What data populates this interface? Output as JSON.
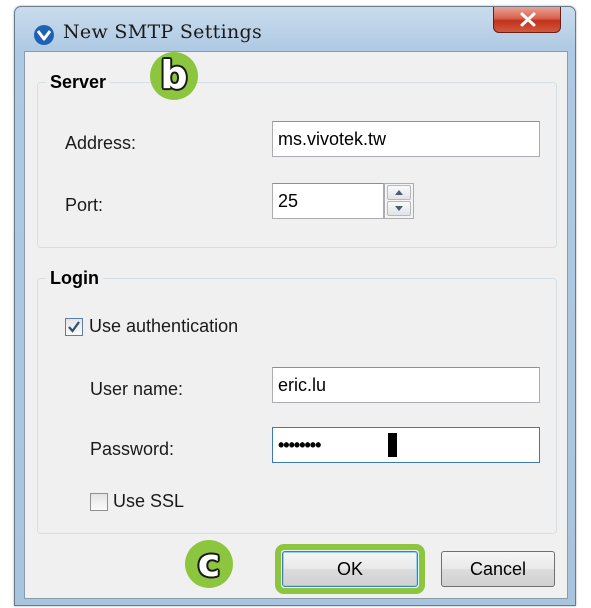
{
  "window": {
    "title": "New SMTP Settings",
    "close_glyph": "x",
    "icon": "vivotek-chevron-icon"
  },
  "server": {
    "group_title": "Server",
    "address_label": "Address:",
    "address_value": "ms.vivotek.tw",
    "port_label": "Port:",
    "port_value": "25"
  },
  "login": {
    "group_title": "Login",
    "use_auth_label": "Use authentication",
    "use_auth_checked": true,
    "username_label": "User name:",
    "username_value": "eric.lu",
    "password_label": "Password:",
    "password_value": "••••••••",
    "use_ssl_label": "Use SSL",
    "use_ssl_checked": false
  },
  "buttons": {
    "ok_label": "OK",
    "cancel_label": "Cancel"
  },
  "annotations": {
    "badge_b": "b",
    "badge_c": "c",
    "accent_color": "#8cc63f"
  }
}
